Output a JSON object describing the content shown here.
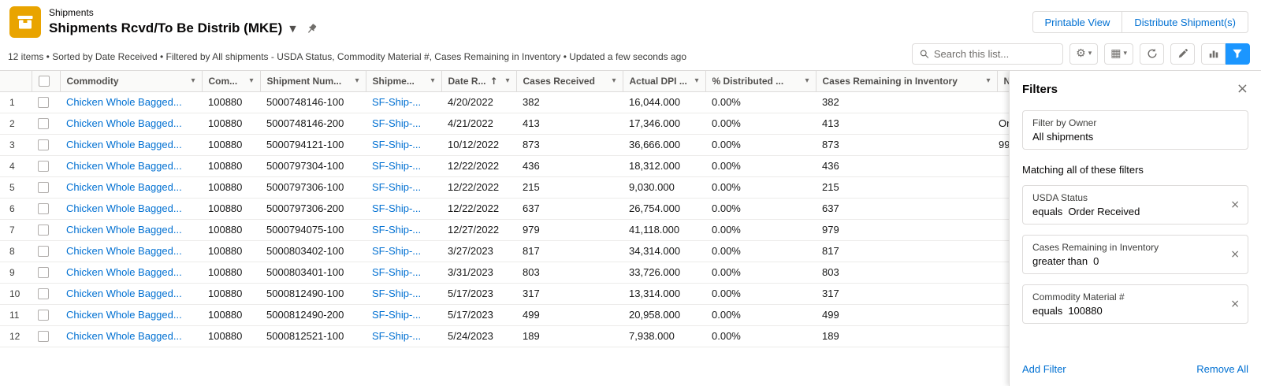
{
  "colors": {
    "brand_blue": "#0070d2",
    "active_filter_button": "#1b96ff",
    "app_icon_background": "#E9A400"
  },
  "icons": {
    "gear": "⚙",
    "display_as": "▦",
    "chevron_down": "▾",
    "title_chevron": "▼",
    "sort_asc": "↑",
    "close": "×"
  },
  "header": {
    "object_label": "Shipments",
    "title": "Shipments Rcvd/To Be Distrib (MKE)",
    "actions": {
      "printable_view": "Printable View",
      "distribute": "Distribute Shipment(s)"
    }
  },
  "toolbar": {
    "summary": "12 items • Sorted by Date Received • Filtered by All shipments - USDA Status, Commodity Material #, Cases Remaining in Inventory • Updated a few seconds ago",
    "search_placeholder": "Search this list..."
  },
  "table": {
    "columns": [
      {
        "label": "Commodity"
      },
      {
        "label": "Com..."
      },
      {
        "label": "Shipment Num..."
      },
      {
        "label": "Shipme..."
      },
      {
        "label": "Date R...",
        "sort": "asc"
      },
      {
        "label": "Cases Received"
      },
      {
        "label": "Actual DPI ..."
      },
      {
        "label": "% Distributed ..."
      },
      {
        "label": "Cases Remaining in Inventory"
      },
      {
        "label": "No..."
      }
    ],
    "rows": [
      {
        "num": "1",
        "commodity": "Chicken Whole Bagged...",
        "commodity_material": "100880",
        "shipment_number": "5000748146-100",
        "shipment": "SF-Ship-...",
        "date_received": "4/20/2022",
        "cases_received": "382",
        "actual_dpi": "16,044.000",
        "pct_distributed": "0.00%",
        "cases_remaining": "382",
        "note": ""
      },
      {
        "num": "2",
        "commodity": "Chicken Whole Bagged...",
        "commodity_material": "100880",
        "shipment_number": "5000748146-200",
        "shipment": "SF-Ship-...",
        "date_received": "4/21/2022",
        "cases_received": "413",
        "actual_dpi": "17,346.000",
        "pct_distributed": "0.00%",
        "cases_remaining": "413",
        "note": "Or"
      },
      {
        "num": "3",
        "commodity": "Chicken Whole Bagged...",
        "commodity_material": "100880",
        "shipment_number": "5000794121-100",
        "shipment": "SF-Ship-...",
        "date_received": "10/12/2022",
        "cases_received": "873",
        "actual_dpi": "36,666.000",
        "pct_distributed": "0.00%",
        "cases_remaining": "873",
        "note": "99"
      },
      {
        "num": "4",
        "commodity": "Chicken Whole Bagged...",
        "commodity_material": "100880",
        "shipment_number": "5000797304-100",
        "shipment": "SF-Ship-...",
        "date_received": "12/22/2022",
        "cases_received": "436",
        "actual_dpi": "18,312.000",
        "pct_distributed": "0.00%",
        "cases_remaining": "436",
        "note": ""
      },
      {
        "num": "5",
        "commodity": "Chicken Whole Bagged...",
        "commodity_material": "100880",
        "shipment_number": "5000797306-100",
        "shipment": "SF-Ship-...",
        "date_received": "12/22/2022",
        "cases_received": "215",
        "actual_dpi": "9,030.000",
        "pct_distributed": "0.00%",
        "cases_remaining": "215",
        "note": ""
      },
      {
        "num": "6",
        "commodity": "Chicken Whole Bagged...",
        "commodity_material": "100880",
        "shipment_number": "5000797306-200",
        "shipment": "SF-Ship-...",
        "date_received": "12/22/2022",
        "cases_received": "637",
        "actual_dpi": "26,754.000",
        "pct_distributed": "0.00%",
        "cases_remaining": "637",
        "note": ""
      },
      {
        "num": "7",
        "commodity": "Chicken Whole Bagged...",
        "commodity_material": "100880",
        "shipment_number": "5000794075-100",
        "shipment": "SF-Ship-...",
        "date_received": "12/27/2022",
        "cases_received": "979",
        "actual_dpi": "41,118.000",
        "pct_distributed": "0.00%",
        "cases_remaining": "979",
        "note": ""
      },
      {
        "num": "8",
        "commodity": "Chicken Whole Bagged...",
        "commodity_material": "100880",
        "shipment_number": "5000803402-100",
        "shipment": "SF-Ship-...",
        "date_received": "3/27/2023",
        "cases_received": "817",
        "actual_dpi": "34,314.000",
        "pct_distributed": "0.00%",
        "cases_remaining": "817",
        "note": ""
      },
      {
        "num": "9",
        "commodity": "Chicken Whole Bagged...",
        "commodity_material": "100880",
        "shipment_number": "5000803401-100",
        "shipment": "SF-Ship-...",
        "date_received": "3/31/2023",
        "cases_received": "803",
        "actual_dpi": "33,726.000",
        "pct_distributed": "0.00%",
        "cases_remaining": "803",
        "note": ""
      },
      {
        "num": "10",
        "commodity": "Chicken Whole Bagged...",
        "commodity_material": "100880",
        "shipment_number": "5000812490-100",
        "shipment": "SF-Ship-...",
        "date_received": "5/17/2023",
        "cases_received": "317",
        "actual_dpi": "13,314.000",
        "pct_distributed": "0.00%",
        "cases_remaining": "317",
        "note": ""
      },
      {
        "num": "11",
        "commodity": "Chicken Whole Bagged...",
        "commodity_material": "100880",
        "shipment_number": "5000812490-200",
        "shipment": "SF-Ship-...",
        "date_received": "5/17/2023",
        "cases_received": "499",
        "actual_dpi": "20,958.000",
        "pct_distributed": "0.00%",
        "cases_remaining": "499",
        "note": ""
      },
      {
        "num": "12",
        "commodity": "Chicken Whole Bagged...",
        "commodity_material": "100880",
        "shipment_number": "5000812521-100",
        "shipment": "SF-Ship-...",
        "date_received": "5/24/2023",
        "cases_received": "189",
        "actual_dpi": "7,938.000",
        "pct_distributed": "0.00%",
        "cases_remaining": "189",
        "note": ""
      }
    ]
  },
  "filters_panel": {
    "title": "Filters",
    "owner": {
      "label": "Filter by Owner",
      "value": "All shipments"
    },
    "matching_label": "Matching all of these filters",
    "filters": [
      {
        "field": "USDA Status",
        "operator": "equals",
        "value": "Order Received"
      },
      {
        "field": "Cases Remaining in Inventory",
        "operator": "greater than",
        "value": "0"
      },
      {
        "field": "Commodity Material #",
        "operator": "equals",
        "value": "100880"
      }
    ],
    "add_filter_label": "Add Filter",
    "remove_all_label": "Remove All"
  }
}
